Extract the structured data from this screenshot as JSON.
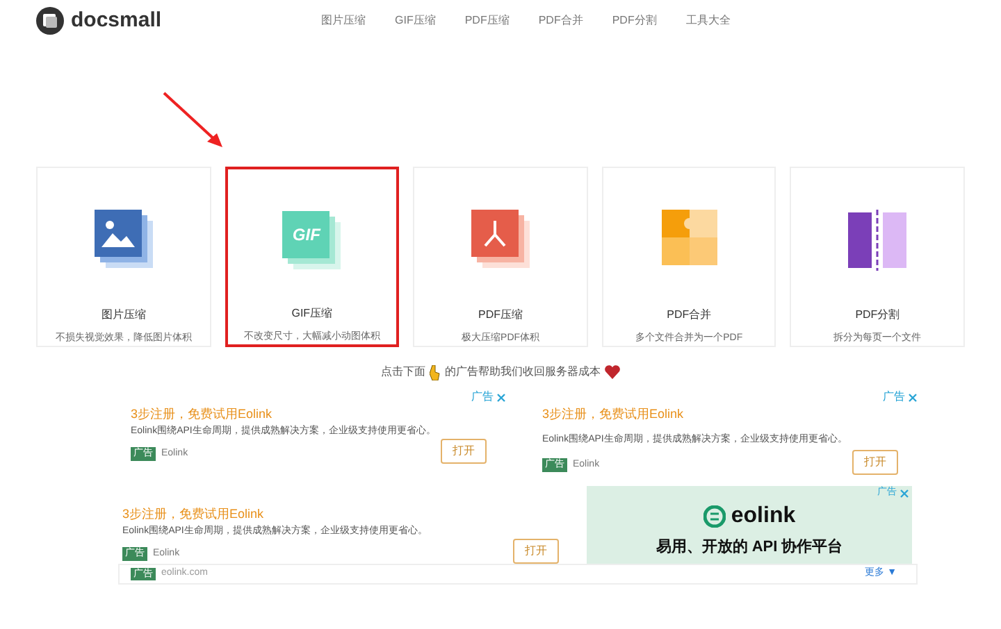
{
  "header": {
    "logo": "docsmall",
    "nav": [
      "图片压缩",
      "GIF压缩",
      "PDF压缩",
      "PDF合并",
      "PDF分割",
      "工具大全"
    ]
  },
  "tools": [
    {
      "kind": "image",
      "title": "图片压缩",
      "desc": "不损失视觉效果，降低图片体积",
      "highlighted": false
    },
    {
      "kind": "gif",
      "icon_text": "GIF",
      "title": "GIF压缩",
      "desc": "不改变尺寸，大幅减小动图体积",
      "highlighted": true
    },
    {
      "kind": "pdf",
      "title": "PDF压缩",
      "desc": "极大压缩PDF体积",
      "highlighted": false
    },
    {
      "kind": "merge",
      "title": "PDF合并",
      "desc": "多个文件合并为一个PDF",
      "highlighted": false
    },
    {
      "kind": "split",
      "title": "PDF分割",
      "desc": "拆分为每页一个文件",
      "highlighted": false
    }
  ],
  "notice": {
    "before": "点击下面",
    "after": "的广告帮助我们收回服务器成本"
  },
  "ads": [
    {
      "corner": "广告",
      "title": "3步注册，免费试用Eolink",
      "desc": "Eolink围绕API生命周期，提供成熟解决方案，企业级支持使用更省心。",
      "badge": "广告",
      "source": "Eolink",
      "button": "打开"
    },
    {
      "corner": "广告",
      "title": "3步注册，免费试用Eolink",
      "desc": "Eolink围绕API生命周期，提供成熟解决方案，企业级支持使用更省心。",
      "badge": "广告",
      "source": "Eolink",
      "button": "打开"
    },
    {
      "title": "3步注册，免费试用Eolink",
      "desc": "Eolink围绕API生命周期，提供成熟解决方案，企业级支持使用更省心。",
      "badge": "广告",
      "source": "Eolink",
      "button": "打开"
    }
  ],
  "banner": {
    "corner": "广告",
    "logo": "eolink",
    "slogan": "易用、开放的 API 协作平台"
  },
  "bottom_bar": {
    "badge": "广告",
    "domain": "eolink.com",
    "more": "更多 ▼"
  }
}
